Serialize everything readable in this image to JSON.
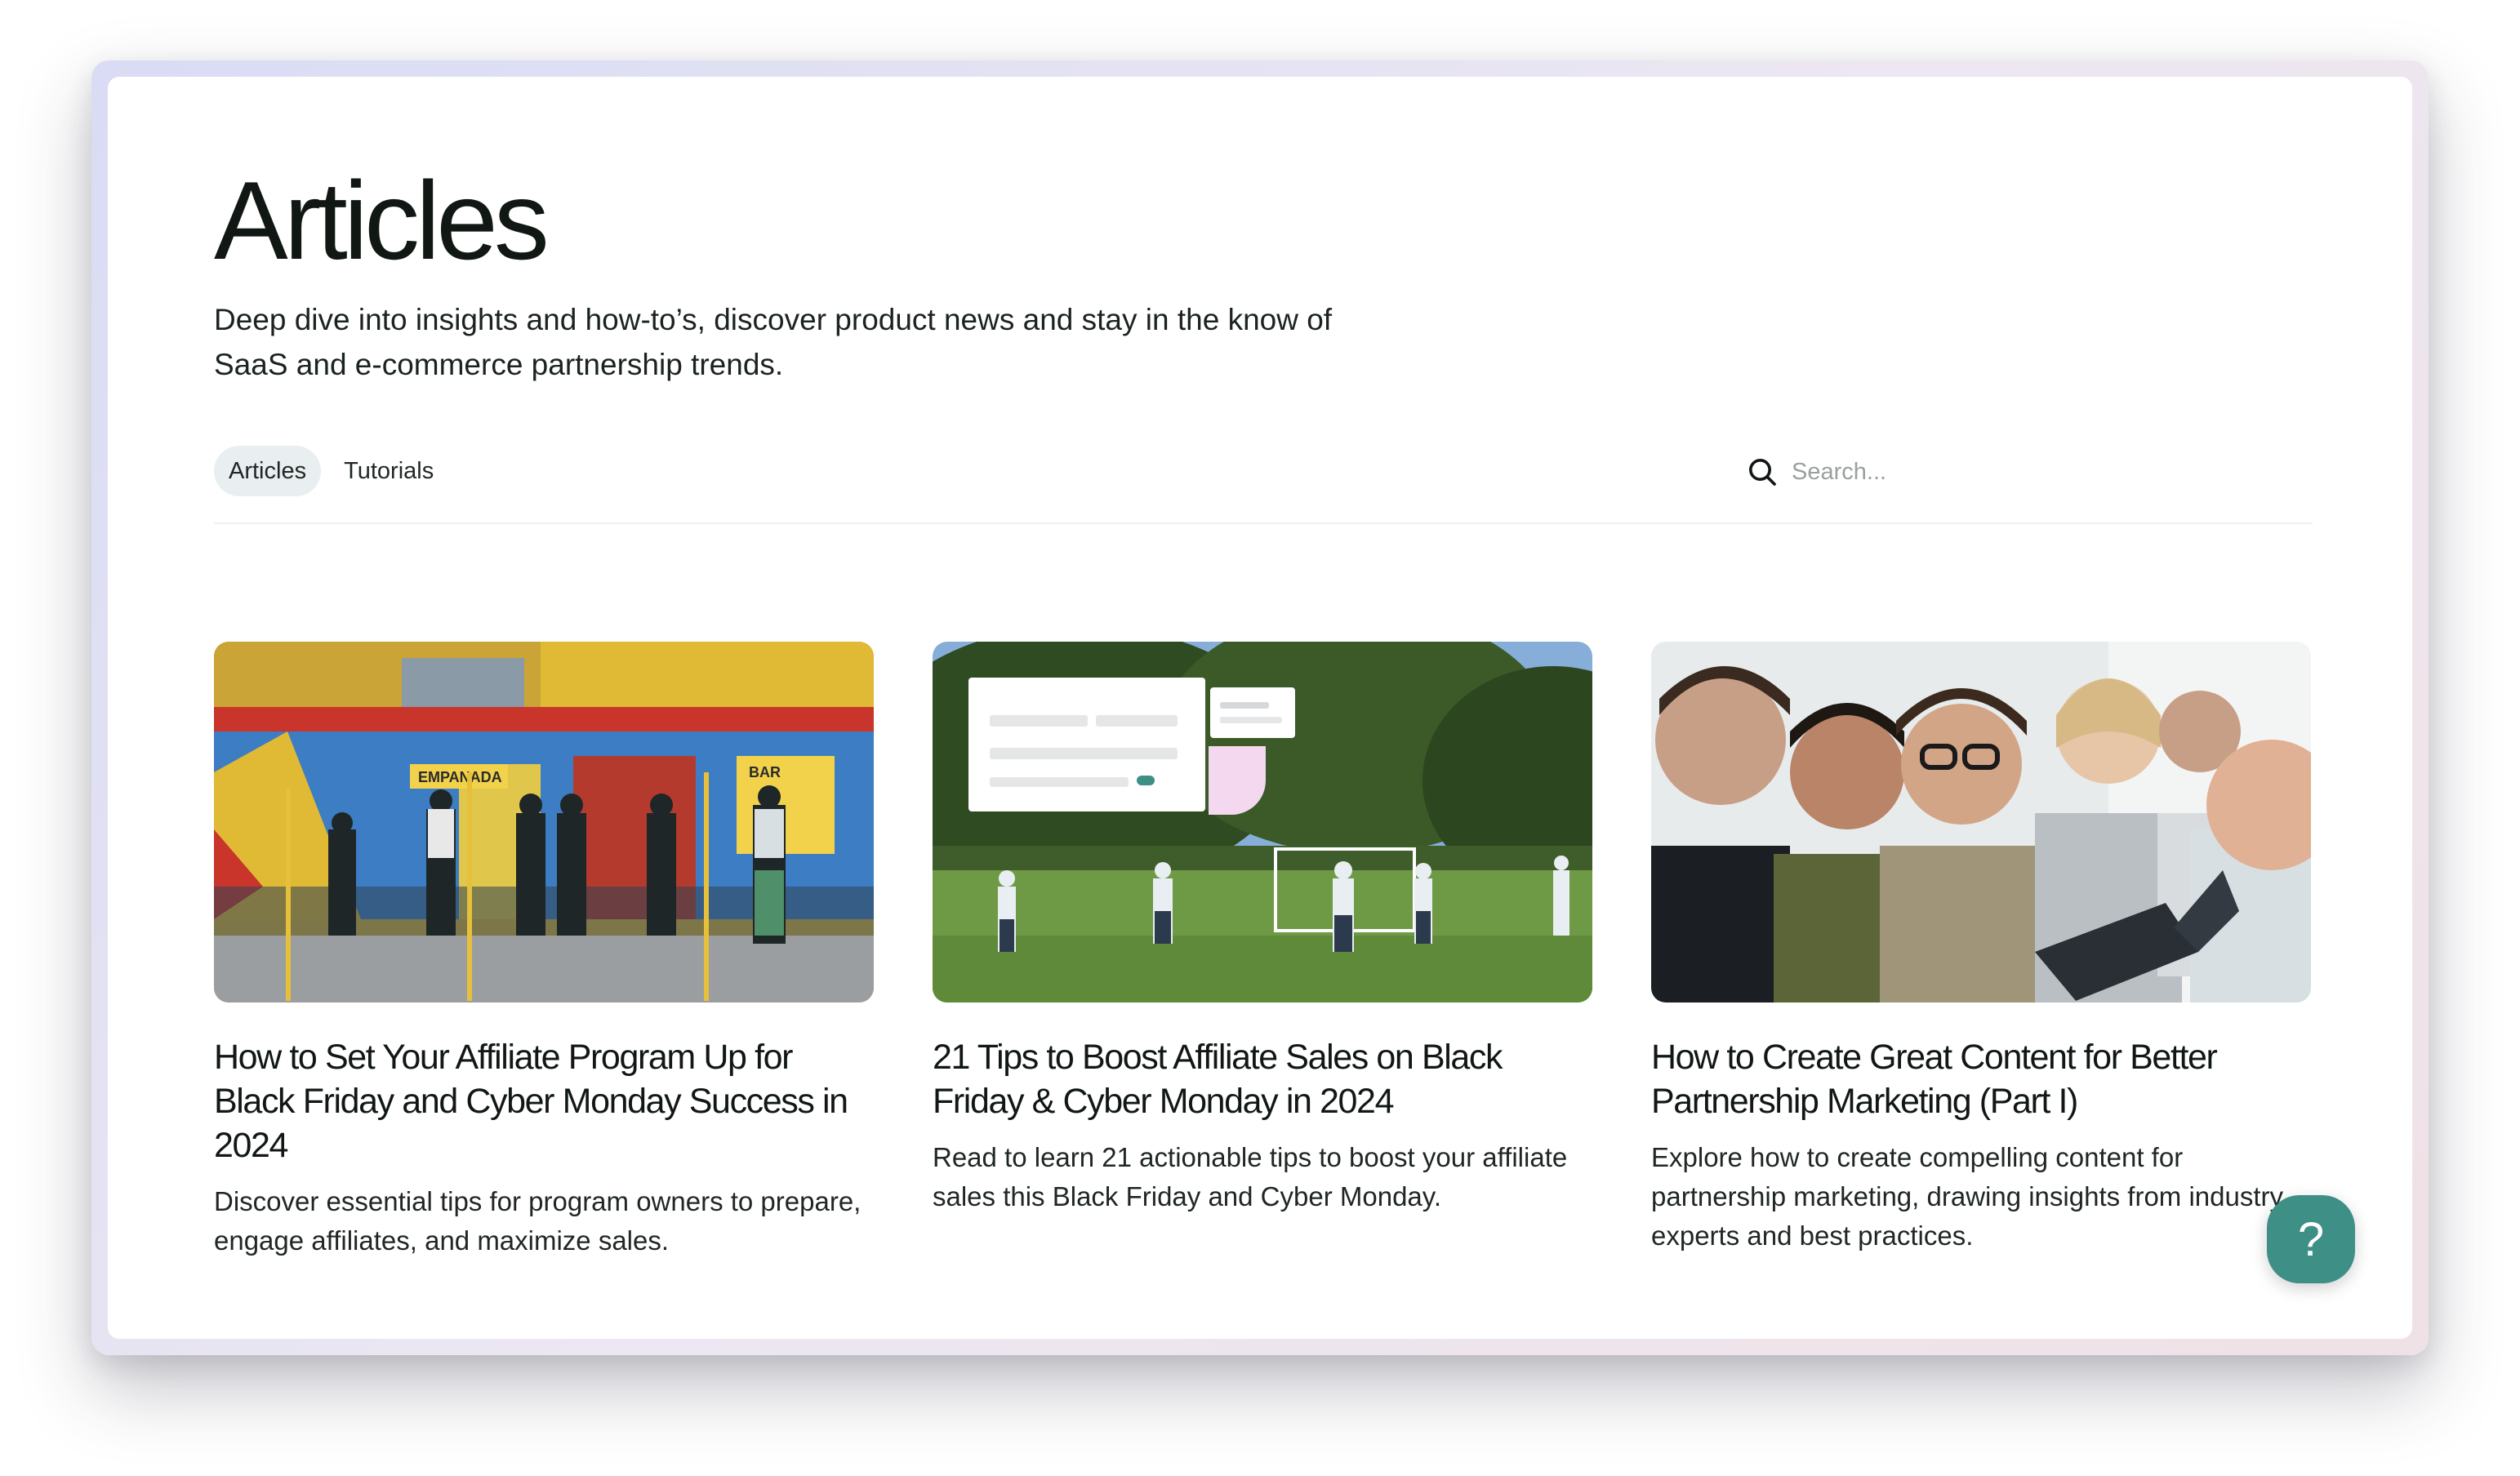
{
  "page": {
    "title": "Articles",
    "subtitle": "Deep dive into insights and how-to’s, discover product news and stay in the know of SaaS and e-commerce partnership trends."
  },
  "tabs": [
    {
      "label": "Articles",
      "active": true
    },
    {
      "label": "Tutorials",
      "active": false
    }
  ],
  "search": {
    "placeholder": "Search...",
    "value": "",
    "icon": "search-icon"
  },
  "articles": [
    {
      "title": "How to Set Your Affiliate Program Up for Black Friday and Cyber Monday Success in 2024",
      "description": "Discover essential tips for program owners to prepare, engage affiliates, and maximize sales.",
      "image": "group-standing-in-front-of-colorful-storefront",
      "image_signs": [
        "EMPANADA",
        "BAR"
      ]
    },
    {
      "title": "21 Tips to Boost Affiliate Sales on Black Friday & Cyber Monday in 2024",
      "description": "Read to learn 21 actionable tips to boost your affiliate sales this Black Friday and Cyber Monday.",
      "image": "people-playing-football-in-park-with-ui-overlay"
    },
    {
      "title": "How to Create Great Content for Better Partnership Marketing (Part I)",
      "description": "Explore how to create compelling content for partnership marketing, drawing insights from industry experts and best practices.",
      "image": "team-working-on-laptops"
    }
  ],
  "help_button": {
    "label": "?",
    "icon": "help-icon"
  },
  "colors": {
    "text": "#111814",
    "tab_active_bg": "#e9eef1",
    "help_button": "#3e8f86",
    "placeholder": "#9aa09e"
  }
}
